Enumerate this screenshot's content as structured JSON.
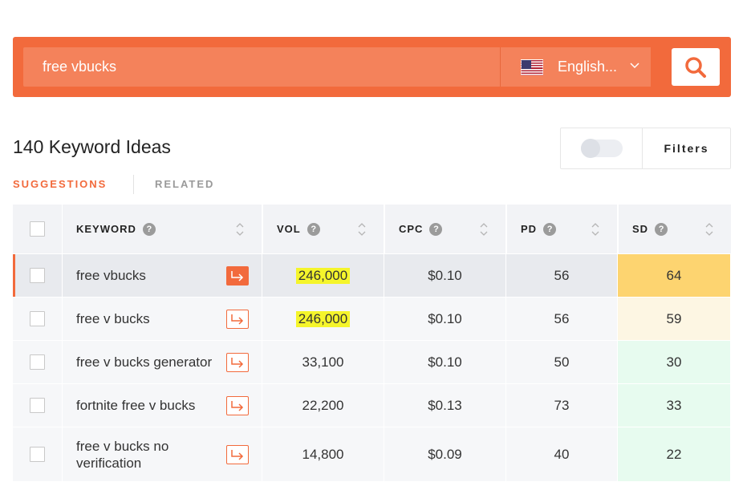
{
  "search": {
    "query": "free vbucks",
    "language": "English...",
    "colors": {
      "bar": "#f26a3c",
      "input": "#f4825b"
    }
  },
  "header": {
    "ideas_title": "140 Keyword Ideas",
    "filters_label": "Filters"
  },
  "tabs": [
    {
      "label": "SUGGESTIONS",
      "active": true
    },
    {
      "label": "RELATED",
      "active": false
    }
  ],
  "table": {
    "columns": [
      "KEYWORD",
      "VOL",
      "CPC",
      "PD",
      "SD"
    ],
    "rows": [
      {
        "keyword": "free vbucks",
        "vol": "246,000",
        "cpc": "$0.10",
        "pd": "56",
        "sd": "64",
        "sd_color": "#fdd470",
        "highlight_vol": true,
        "active": true
      },
      {
        "keyword": "free v bucks",
        "vol": "246,000",
        "cpc": "$0.10",
        "pd": "56",
        "sd": "59",
        "sd_color": "#fdf6e3",
        "highlight_vol": true,
        "active": false
      },
      {
        "keyword": "free v bucks generator",
        "vol": "33,100",
        "cpc": "$0.10",
        "pd": "50",
        "sd": "30",
        "sd_color": "#e7fbef",
        "highlight_vol": false,
        "active": false
      },
      {
        "keyword": "fortnite free v bucks",
        "vol": "22,200",
        "cpc": "$0.13",
        "pd": "73",
        "sd": "33",
        "sd_color": "#e7fbef",
        "highlight_vol": false,
        "active": false
      },
      {
        "keyword": "free v bucks no verification",
        "vol": "14,800",
        "cpc": "$0.09",
        "pd": "40",
        "sd": "22",
        "sd_color": "#e7fbef",
        "highlight_vol": false,
        "active": false
      }
    ]
  },
  "icons": {
    "search": "search-icon",
    "flag": "us-flag-icon",
    "chevron": "chevron-down-icon",
    "help": "question-mark-icon",
    "sort": "sort-icon",
    "arrow": "arrow-right-icon"
  }
}
